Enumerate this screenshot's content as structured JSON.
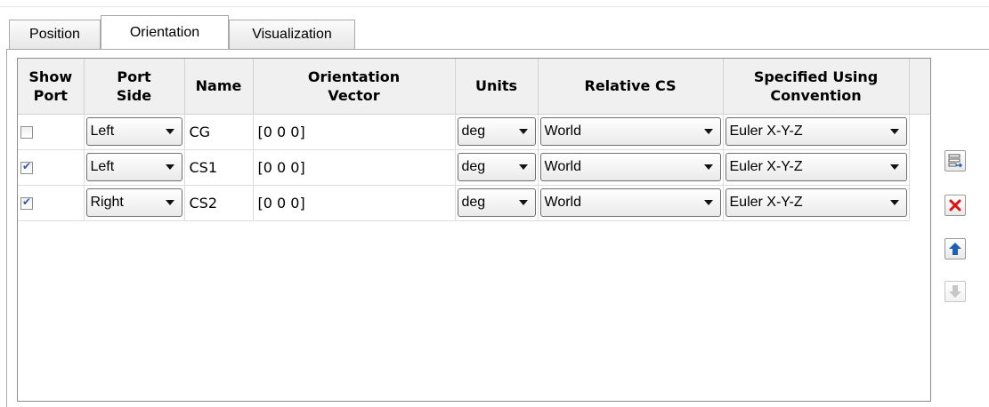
{
  "tabs": [
    {
      "label": "Position"
    },
    {
      "label": "Orientation",
      "active": true
    },
    {
      "label": "Visualization"
    }
  ],
  "table": {
    "headers": {
      "show_port": [
        "Show",
        "Port"
      ],
      "port_side": [
        "Port",
        "Side"
      ],
      "name": "Name",
      "orientation_vector": [
        "Orientation",
        "Vector"
      ],
      "units": "Units",
      "relative_cs": "Relative CS",
      "convention": [
        "Specified Using",
        "Convention"
      ]
    },
    "rows": [
      {
        "show_port": false,
        "port_side": "Left",
        "name": "CG",
        "vector": "[0 0 0]",
        "units": "deg",
        "relative_cs": "World",
        "convention": "Euler X-Y-Z"
      },
      {
        "show_port": true,
        "port_side": "Left",
        "name": "CS1",
        "vector": "[0 0 0]",
        "units": "deg",
        "relative_cs": "World",
        "convention": "Euler X-Y-Z"
      },
      {
        "show_port": true,
        "port_side": "Right",
        "name": "CS2",
        "vector": "[0 0 0]",
        "units": "deg",
        "relative_cs": "World",
        "convention": "Euler X-Y-Z"
      }
    ]
  },
  "side_buttons": [
    {
      "icon": "add-row-icon",
      "enabled": true
    },
    {
      "icon": "delete-icon",
      "color": "#e01010",
      "enabled": true
    },
    {
      "icon": "move-up-icon",
      "color": "#1f5fb4",
      "enabled": true
    },
    {
      "icon": "move-down-icon",
      "color": "#9a9a9a",
      "enabled": false
    }
  ]
}
